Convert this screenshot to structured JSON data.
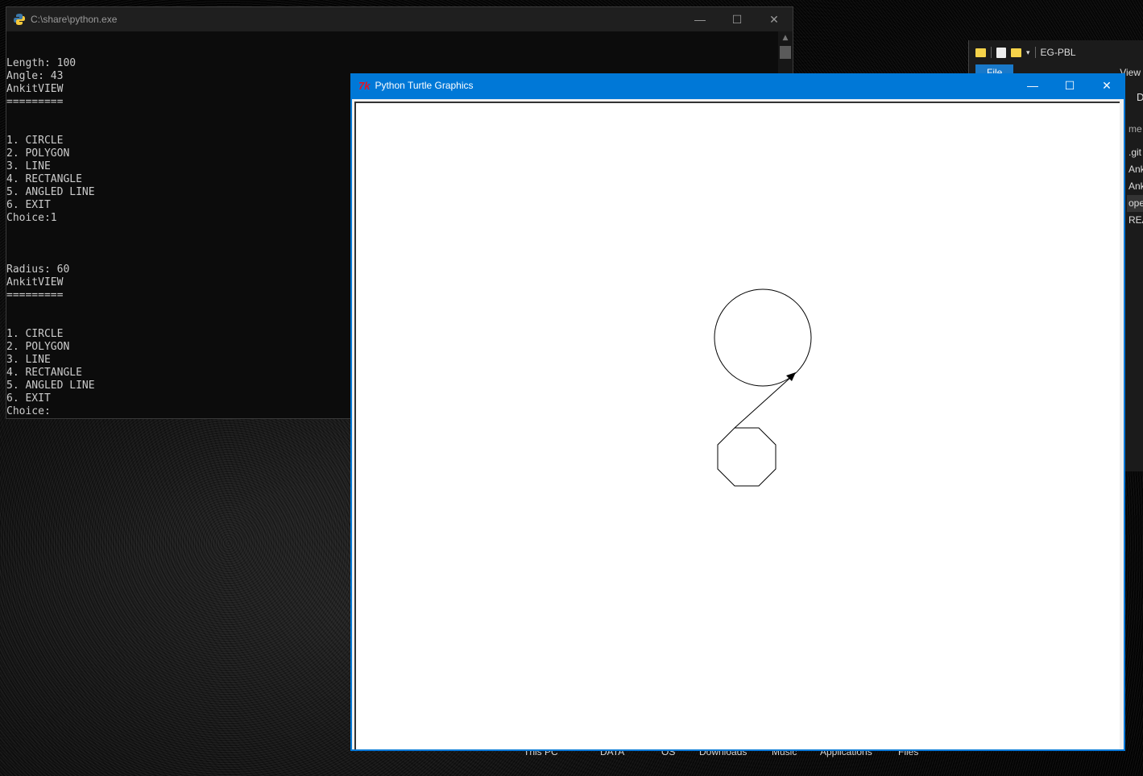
{
  "console": {
    "title": "C:\\share\\python.exe",
    "output": "Length: 100\nAngle: 43\nAnkitVIEW\n=========\n\n\n1. CIRCLE\n2. POLYGON\n3. LINE\n4. RECTANGLE\n5. ANGLED LINE\n6. EXIT\nChoice:1\n\n\n\nRadius: 60\nAnkitVIEW\n=========\n\n\n1. CIRCLE\n2. POLYGON\n3. LINE\n4. RECTANGLE\n5. ANGLED LINE\n6. EXIT\nChoice:"
  },
  "turtle": {
    "title": "Python Turtle Graphics",
    "app_icon": "tk-feather-icon"
  },
  "explorer": {
    "title": "EG-PBL",
    "ribbon": {
      "file": "File",
      "view": "View"
    },
    "side_header": "me",
    "side_items": [
      ".git",
      "Ank",
      "Ank",
      "ope",
      "REA"
    ],
    "tab_label": "D"
  },
  "window_controls": {
    "minimize": "—",
    "maximize": "☐",
    "close": "✕"
  },
  "taskbar_labels": [
    "This PC",
    "DATA",
    "OS",
    "Downloads",
    "Music",
    "Applications",
    "Files"
  ]
}
